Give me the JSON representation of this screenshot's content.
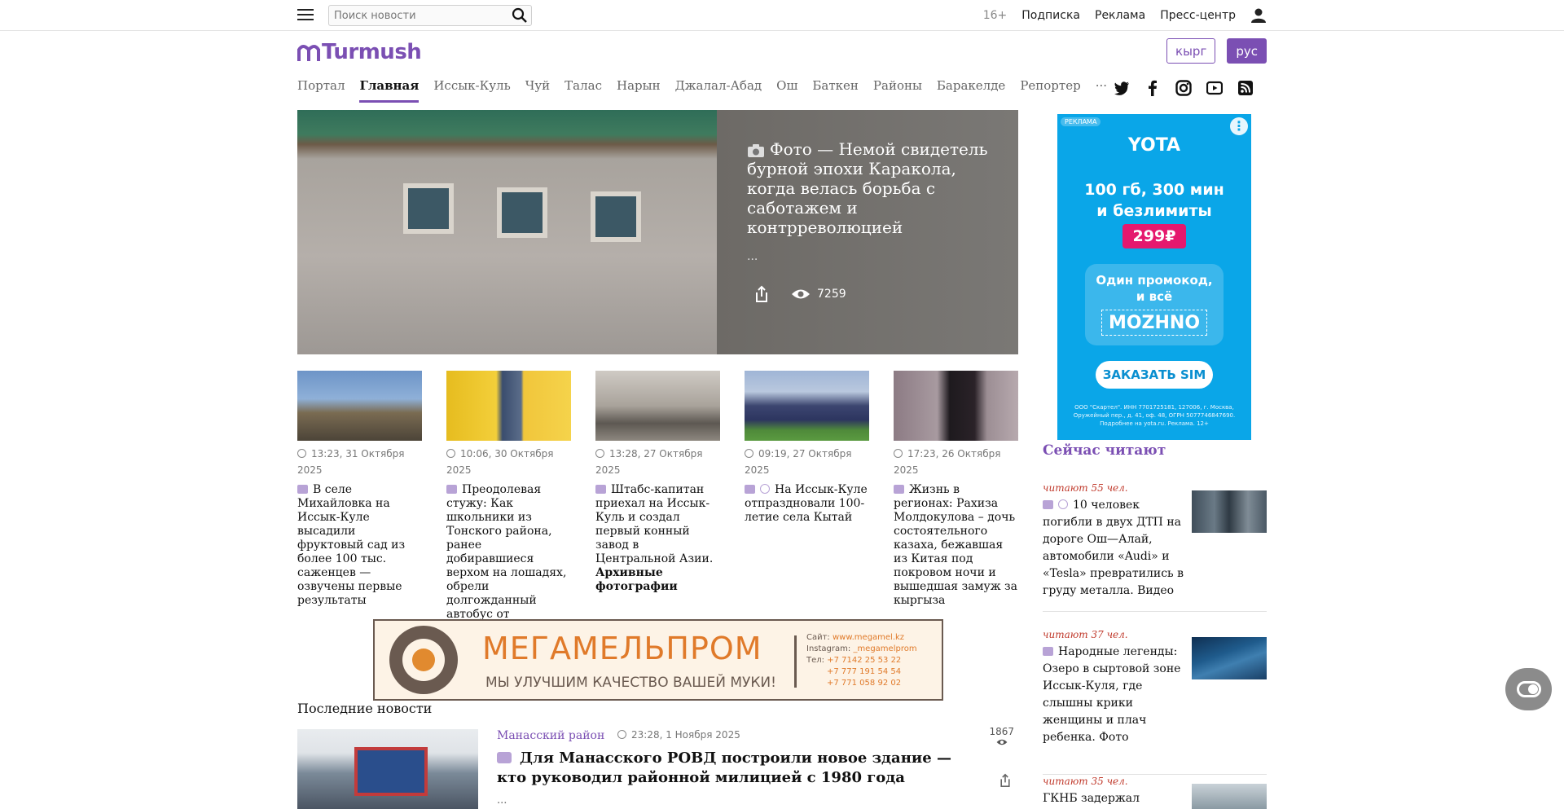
{
  "topbar": {
    "search_placeholder": "Поиск новости",
    "age_rating": "16+",
    "links": [
      "Подписка",
      "Реклама",
      "Пресс-центр"
    ]
  },
  "header": {
    "logo_text": "Turmush",
    "lang_kg": "кырг",
    "lang_ru": "рус"
  },
  "nav": {
    "items": [
      "Портал",
      "Главная",
      "Иссык-Куль",
      "Чуй",
      "Талас",
      "Нарын",
      "Джалал-Абад",
      "Ош",
      "Баткен",
      "Районы",
      "Баракелде",
      "Репортер"
    ],
    "active": "Главная",
    "more": "···",
    "socials": [
      "twitter-icon",
      "facebook-icon",
      "instagram-icon",
      "youtube-icon",
      "rss-icon"
    ]
  },
  "hero": {
    "title": "Фото — Немой свидетель бурной эпохи Каракола, когда велась борьба с саботажем и контрреволюцией",
    "ellipsis": "...",
    "views": "7259"
  },
  "cards": [
    {
      "date": "13:23, 31 Октября 2025",
      "title": "В селе Михайловка на Иссык-Куле высадили фруктовый сад из более 100 тыс. саженцев — озвучены первые результаты",
      "bold": "",
      "photo": true,
      "video": false,
      "color": "#5f7fa8"
    },
    {
      "date": "10:06, 30 Октября 2025",
      "title": "Преодолевая стужу: Как школьники из Тонского района, ранее добиравшиеся верхом на лошадях, обрели долгожданный автобус от «Евразии»",
      "bold": "",
      "photo": true,
      "video": false,
      "color": "#e0b81c"
    },
    {
      "date": "13:28, 27 Октября 2025",
      "title": "Штабс-капитан приехал на Иссык-Куль и создал первый конный завод в Центральной Азии. ",
      "bold": "Архивные фотографии",
      "photo": true,
      "video": false,
      "color": "#7a7570"
    },
    {
      "date": "09:19, 27 Октября 2025",
      "title": "На Иссык-Куле отпраздновали 100-летие села Кытай",
      "bold": "",
      "photo": true,
      "video": true,
      "color": "#4a5a8a"
    },
    {
      "date": "17:23, 26 Октября 2025",
      "title": "Жизнь в регионах: Рахиза Молдокулова – дочь состоятельного казаха, бежавшая из Китая под покровом ночи и вышедшая замуж за кыргыза",
      "bold": "",
      "photo": true,
      "video": false,
      "color": "#6b5a6e"
    }
  ],
  "banner": {
    "brand": "МЕГАМЕЛЬПРОМ",
    "slogan": "МЫ УЛУЧШИМ КАЧЕСТВО ВАШЕЙ МУКИ!",
    "site_label": "Сайт:",
    "site": "www.megamel.kz",
    "ig_label": "Instagram:",
    "ig": "_megamelprom",
    "tel_label": "Тел:",
    "tel1": "+7 7142 25 53 22",
    "tel2": "+7 777 191 54 54",
    "tel3": "+7 771 058 92 02"
  },
  "latest": {
    "heading": "Последние новости",
    "item": {
      "category": "Манасский район",
      "date": "23:28, 1 Ноября 2025",
      "title": "Для Манасского РОВД построили новое здание — кто руководил районной милицией с 1980 года",
      "ellipsis": "...",
      "views": "1867"
    }
  },
  "side_ad": {
    "tag": "РЕКЛАМА",
    "brand": "YOTA",
    "line1": "100 гб, 300 мин",
    "line2": "и безлимиты",
    "price": "299₽",
    "promo_text1": "Один промокод,",
    "promo_text2": "и всё",
    "promo_code": "MOZHNO",
    "button": "ЗАКАЗАТЬ SIM",
    "legal": "ООО \"Скартел\". ИНН 7701725181, 127006, г. Москва, Оружейный пер., д. 41, оф. 48, ОГРН 5077746847690. Подробнее на yota.ru. Реклама. 12+"
  },
  "trending": {
    "heading": "Сейчас читают",
    "items": [
      {
        "readers": "читают 55 чел.",
        "title": "10 человек погибли в двух ДТП на дороге Ош—Алай, автомобили «Audi» и «Tesla» превратились в груду металла. Видео",
        "photo": true,
        "video": true,
        "color": "#4f5f6e"
      },
      {
        "readers": "читают 37 чел.",
        "title": "Народные легенды: Озеро в сыртовой зоне Иссык-Куля, где слышны крики женщины и плач ребенка. Фото",
        "photo": true,
        "video": false,
        "color": "#1f4f7a"
      },
      {
        "readers": "читают 35 чел.",
        "title": "ГКНБ задержал",
        "photo": false,
        "video": false,
        "color": "#8a9aa3"
      }
    ]
  },
  "colors": {
    "accent": "#7b4fb3",
    "readers": "#c0392b"
  }
}
